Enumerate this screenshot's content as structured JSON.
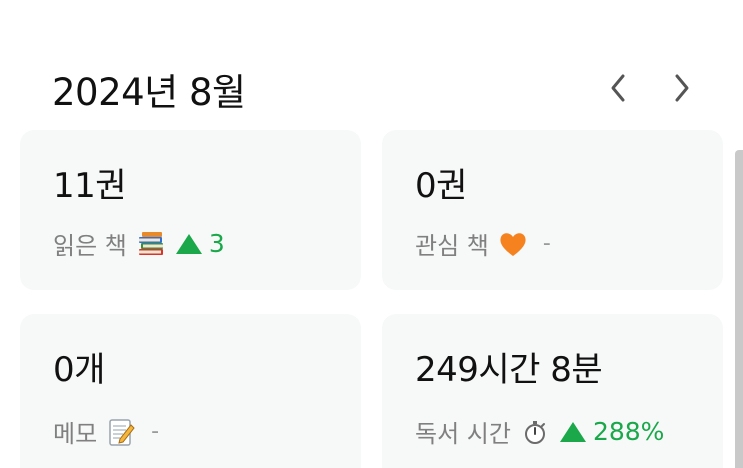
{
  "header": {
    "month_title": "2024년 8월"
  },
  "cards": [
    {
      "value": "11권",
      "label": "읽은 책",
      "icon": "books-icon",
      "trend": "3",
      "trend_direction": "up"
    },
    {
      "value": "0권",
      "label": "관심 책",
      "icon": "orange-heart-icon",
      "trend": "-"
    },
    {
      "value": "0개",
      "label": "메모",
      "icon": "memo-icon",
      "trend": "-"
    },
    {
      "value": "249시간 8분",
      "label": "독서 시간",
      "icon": "stopwatch-icon",
      "trend": "288%",
      "trend_direction": "up"
    }
  ],
  "colors": {
    "trend_up": "#1aa84a",
    "card_bg": "#f7f8f8",
    "label": "#808080"
  }
}
